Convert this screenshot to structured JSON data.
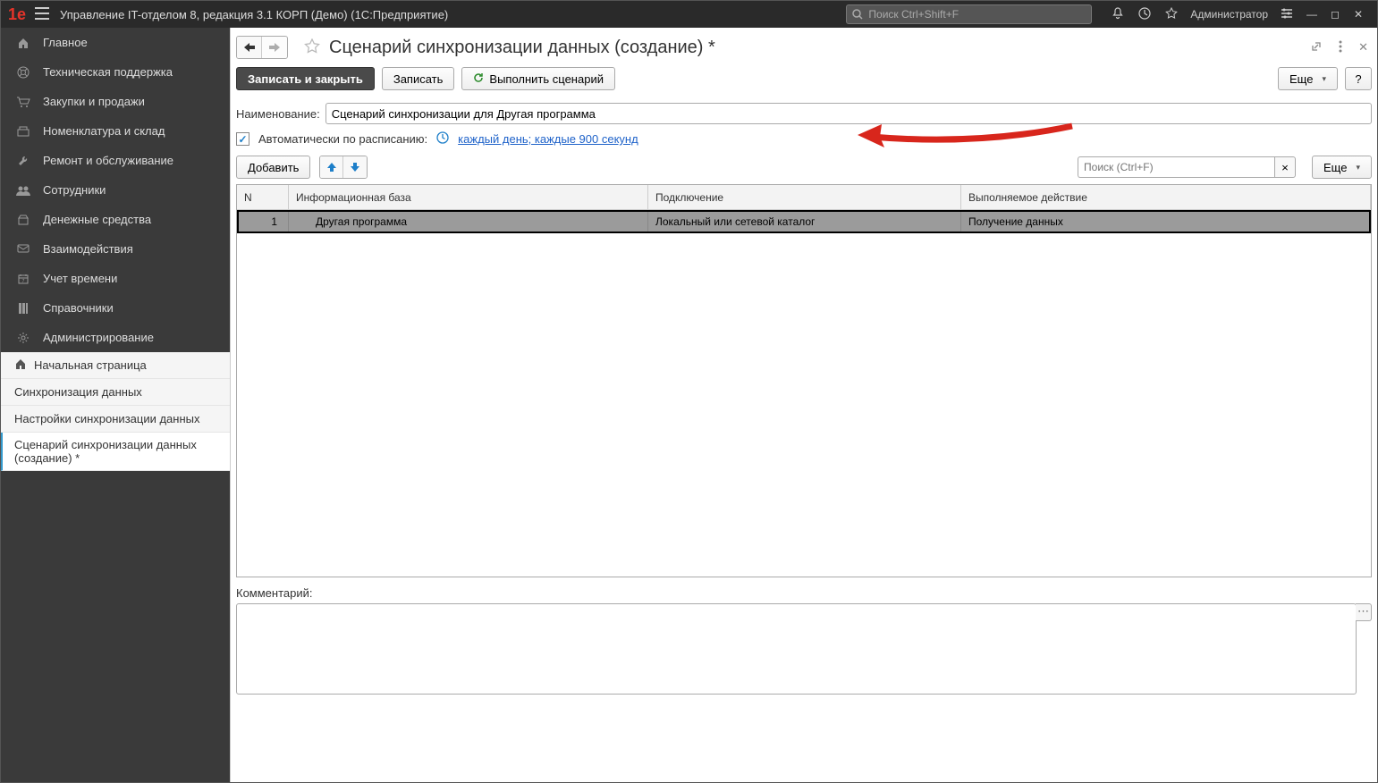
{
  "titlebar": {
    "title": "Управление IT-отделом 8, редакция 3.1 КОРП (Демо)  (1С:Предприятие)",
    "search_placeholder": "Поиск Ctrl+Shift+F",
    "admin": "Администратор"
  },
  "sidebar": {
    "dark": [
      {
        "icon": "home",
        "label": "Главное"
      },
      {
        "icon": "support",
        "label": "Техническая поддержка"
      },
      {
        "icon": "cart",
        "label": "Закупки и продажи"
      },
      {
        "icon": "warehouse",
        "label": "Номенклатура и склад"
      },
      {
        "icon": "wrench",
        "label": "Ремонт и обслуживание"
      },
      {
        "icon": "users",
        "label": "Сотрудники"
      },
      {
        "icon": "money",
        "label": "Денежные средства"
      },
      {
        "icon": "interact",
        "label": "Взаимодействия"
      },
      {
        "icon": "calendar",
        "label": "Учет времени"
      },
      {
        "icon": "books",
        "label": "Справочники"
      },
      {
        "icon": "gear",
        "label": "Администрирование"
      }
    ],
    "light": [
      {
        "icon": "home",
        "label": "Начальная страница",
        "active": false,
        "home": true
      },
      {
        "label": "Синхронизация данных",
        "active": false
      },
      {
        "label": "Настройки синхронизации данных",
        "active": false
      },
      {
        "label": "Сценарий синхронизации данных (создание) *",
        "active": true
      }
    ]
  },
  "page": {
    "title": "Сценарий синхронизации данных (создание) *",
    "save_close": "Записать и закрыть",
    "save": "Записать",
    "run": "Выполнить сценарий",
    "more": "Еще",
    "help": "?",
    "name_label": "Наименование:",
    "name_value": "Сценарий синхронизации для Другая программа",
    "auto_label": "Автоматически по расписанию:",
    "schedule_link": "каждый день; каждые 900 секунд",
    "add": "Добавить",
    "table_search_placeholder": "Поиск (Ctrl+F)",
    "more2": "Еще",
    "columns": {
      "n": "N",
      "ib": "Информационная база",
      "con": "Подключение",
      "act": "Выполняемое действие"
    },
    "rows": [
      {
        "n": "1",
        "ib": "Другая программа",
        "con": "Локальный или сетевой каталог",
        "act": "Получение данных"
      }
    ],
    "comment_label": "Комментарий:"
  }
}
